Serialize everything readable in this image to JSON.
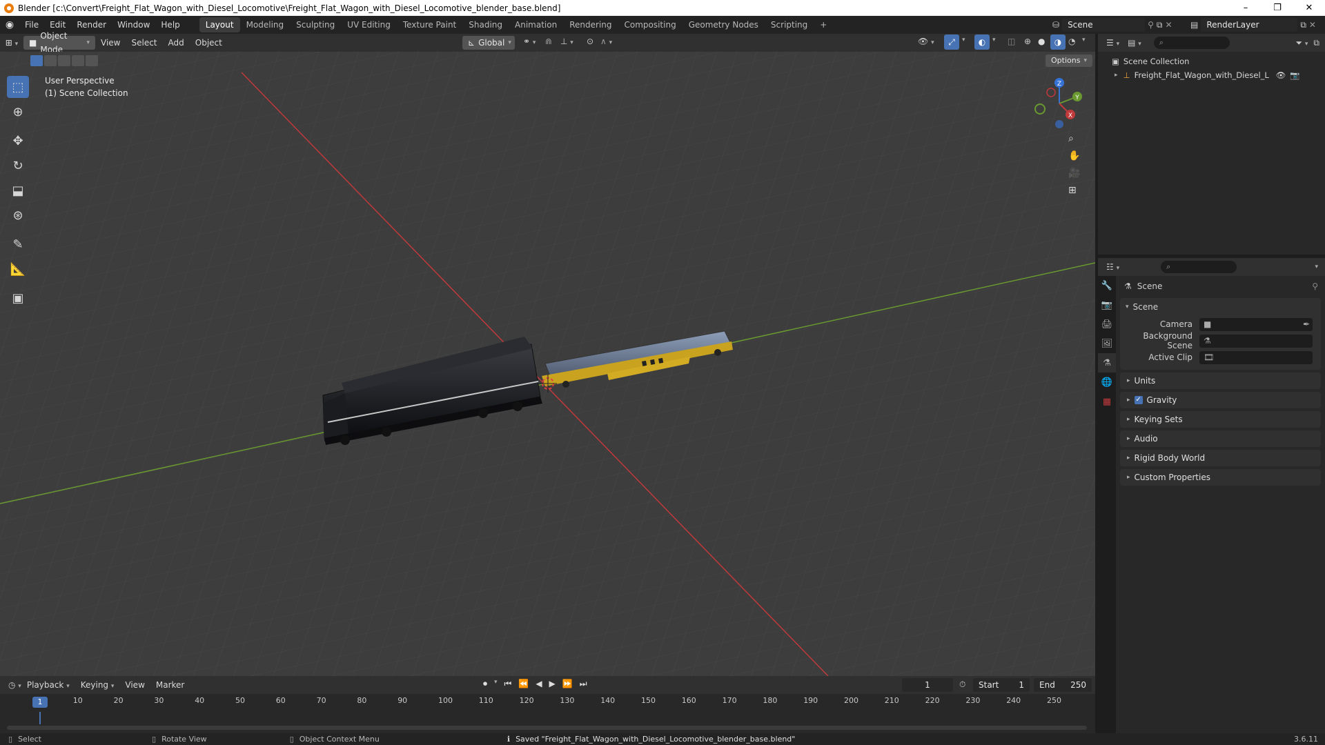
{
  "window": {
    "title": "Blender [c:\\Convert\\Freight_Flat_Wagon_with_Diesel_Locomotive\\Freight_Flat_Wagon_with_Diesel_Locomotive_blender_base.blend]",
    "controls": [
      "–",
      "❐",
      "✕"
    ]
  },
  "menu": {
    "items": [
      "File",
      "Edit",
      "Render",
      "Window",
      "Help"
    ],
    "workspaces": [
      "Layout",
      "Modeling",
      "Sculpting",
      "UV Editing",
      "Texture Paint",
      "Shading",
      "Animation",
      "Rendering",
      "Compositing",
      "Geometry Nodes",
      "Scripting"
    ],
    "active_workspace": "Layout",
    "add_workspace": "+",
    "scene_name": "Scene",
    "view_layer": "RenderLayer"
  },
  "viewport": {
    "mode": "Object Mode",
    "menus": [
      "View",
      "Select",
      "Add",
      "Object"
    ],
    "transform_orientation": "Global",
    "options_label": "Options",
    "perspective_label": "User Perspective",
    "collection_label": "(1) Scene Collection",
    "gizmo_axes": {
      "x": "X",
      "y": "Y",
      "z": "Z"
    },
    "colors": {
      "x_axis": "#c0393b",
      "y_axis": "#6a9a2f",
      "z_axis": "#3572d6",
      "grid": "#474747",
      "background": "#3d3d3d",
      "accent": "#4772b3"
    },
    "tools": [
      "select-box",
      "cursor",
      "move",
      "rotate",
      "scale",
      "transform",
      "annotate",
      "measure",
      "add-cube"
    ]
  },
  "outliner": {
    "root": "Scene Collection",
    "items": [
      {
        "name": "Freight_Flat_Wagon_with_Diesel_Locon",
        "visible": true
      }
    ]
  },
  "properties": {
    "context_title": "Scene",
    "scene_panel": {
      "title": "Scene",
      "fields": [
        {
          "label": "Camera",
          "value": ""
        },
        {
          "label": "Background Scene",
          "value": ""
        },
        {
          "label": "Active Clip",
          "value": ""
        }
      ]
    },
    "collapsed_panels": [
      "Units",
      "Gravity",
      "Keying Sets",
      "Audio",
      "Rigid Body World",
      "Custom Properties"
    ],
    "gravity_enabled": true
  },
  "timeline": {
    "menus": [
      "Playback",
      "Keying",
      "View",
      "Marker"
    ],
    "current_frame": "1",
    "start_label": "Start",
    "start": "1",
    "end_label": "End",
    "end": "250",
    "ruler": [
      "10",
      "20",
      "30",
      "40",
      "50",
      "60",
      "70",
      "80",
      "90",
      "100",
      "110",
      "120",
      "130",
      "140",
      "150",
      "160",
      "170",
      "180",
      "190",
      "200",
      "210",
      "220",
      "230",
      "240",
      "250"
    ],
    "playhead_label": "1"
  },
  "status": {
    "select": "Select",
    "rotate": "Rotate View",
    "context": "Object Context Menu",
    "message": "Saved \"Freight_Flat_Wagon_with_Diesel_Locomotive_blender_base.blend\"",
    "version": "3.6.11"
  }
}
